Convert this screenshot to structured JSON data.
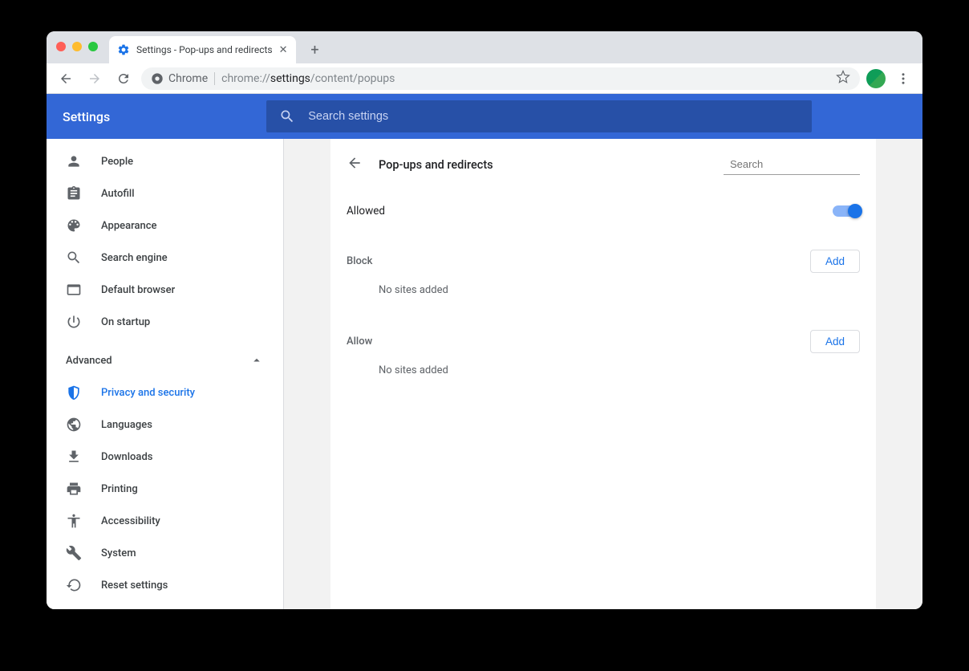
{
  "browser": {
    "tab_title": "Settings - Pop-ups and redirects",
    "omnibox": {
      "chip_label": "Chrome",
      "url_prefix": "chrome://",
      "url_bold": "settings",
      "url_suffix": "/content/popups"
    }
  },
  "header": {
    "title": "Settings",
    "search_placeholder": "Search settings"
  },
  "sidebar": {
    "items": [
      {
        "label": "People",
        "icon": "person"
      },
      {
        "label": "Autofill",
        "icon": "clipboard"
      },
      {
        "label": "Appearance",
        "icon": "palette"
      },
      {
        "label": "Search engine",
        "icon": "search"
      },
      {
        "label": "Default browser",
        "icon": "browser"
      },
      {
        "label": "On startup",
        "icon": "power"
      }
    ],
    "advanced_label": "Advanced",
    "advanced_items": [
      {
        "label": "Privacy and security",
        "icon": "shield",
        "active": true
      },
      {
        "label": "Languages",
        "icon": "globe"
      },
      {
        "label": "Downloads",
        "icon": "download"
      },
      {
        "label": "Printing",
        "icon": "printer"
      },
      {
        "label": "Accessibility",
        "icon": "accessibility"
      },
      {
        "label": "System",
        "icon": "wrench"
      },
      {
        "label": "Reset settings",
        "icon": "restore"
      }
    ]
  },
  "main": {
    "title": "Pop-ups and redirects",
    "search_placeholder": "Search",
    "allowed_label": "Allowed",
    "allowed_on": true,
    "block": {
      "label": "Block",
      "add_label": "Add",
      "empty": "No sites added"
    },
    "allow": {
      "label": "Allow",
      "add_label": "Add",
      "empty": "No sites added"
    }
  }
}
